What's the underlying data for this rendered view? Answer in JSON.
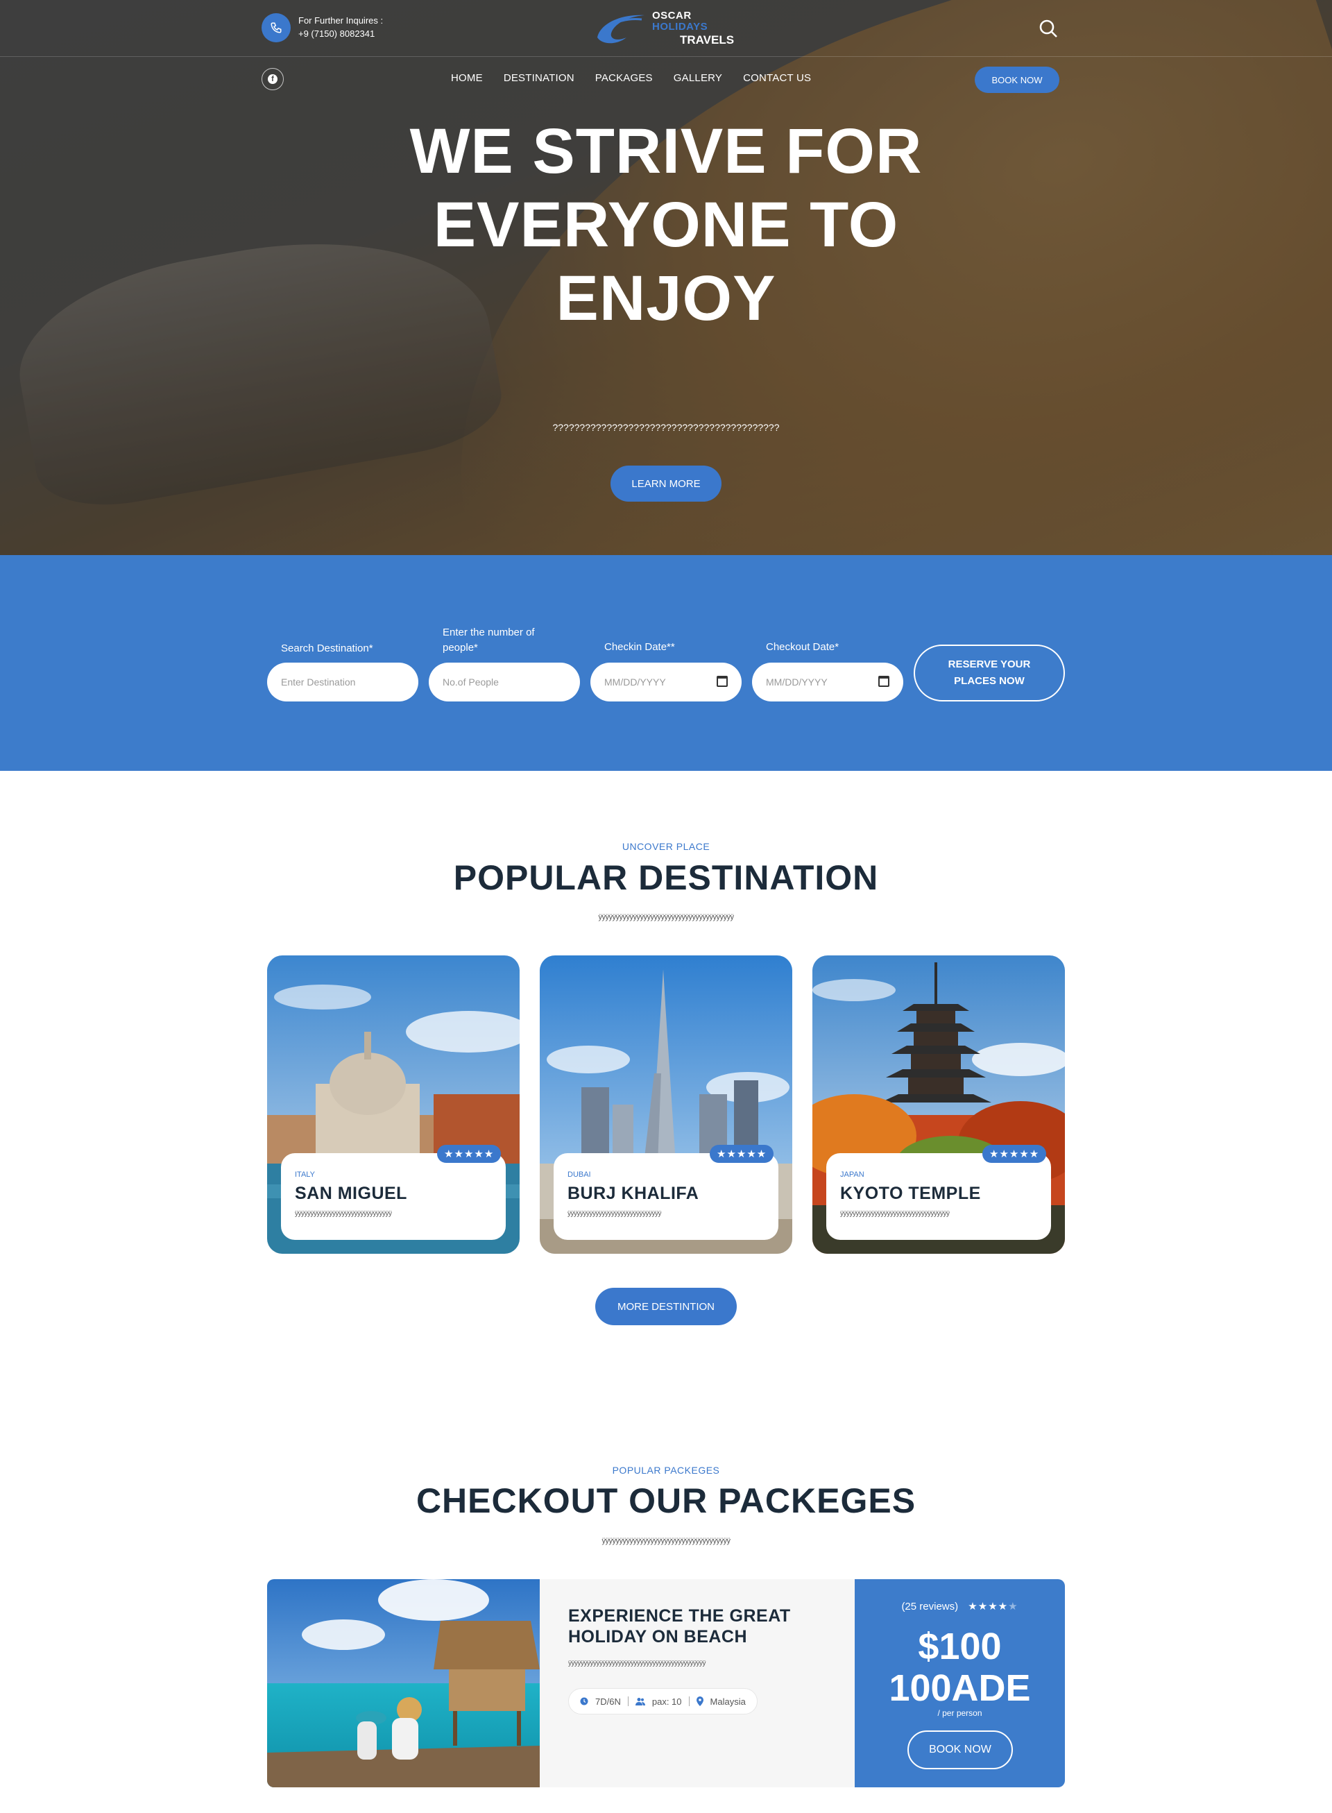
{
  "header": {
    "inquiry_label": "For Further Inquires :",
    "phone": "+9 (7150) 8082341",
    "logo": {
      "line1": "OSCAR",
      "line2": "HOLIDAYS",
      "line3": "TRAVELS"
    },
    "nav": [
      "HOME",
      "DESTINATION",
      "PACKAGES",
      "GALLERY",
      "CONTACT US"
    ],
    "book_now": "BOOK NOW",
    "social": "f",
    "icons": [
      "phone-icon",
      "search-icon",
      "facebook-icon"
    ]
  },
  "hero": {
    "title": "WE STRIVE FOR EVERYONE TO ENJOY",
    "subtitle": "??????????????????????????????????????????",
    "cta": "LEARN MORE"
  },
  "booking": {
    "destination": {
      "label": "Search Destination*",
      "placeholder": "Enter Destination"
    },
    "people": {
      "label": "Enter the number of people*",
      "placeholder": "No.of People"
    },
    "checkin": {
      "label": "Checkin Date**",
      "placeholder": "MM/DD/YYYY"
    },
    "checkout": {
      "label": "Checkout Date*",
      "placeholder": "MM/DD/YYYY"
    },
    "submit": "RESERVE YOUR PLACES NOW"
  },
  "destinations": {
    "eyebrow": "UNCOVER PLACE",
    "title": "POPULAR DESTINATION",
    "subtitle": "ÿÿÿÿÿÿÿÿÿÿÿÿÿÿÿÿÿÿÿÿÿÿÿÿÿÿÿÿÿÿÿÿÿÿÿÿÿÿÿ",
    "cards": [
      {
        "country": "ITALY",
        "name": "SAN MIGUEL",
        "rating": "★★★★★",
        "rating_value": 5,
        "desc": "ÿÿÿÿÿÿÿÿÿÿÿÿÿÿÿÿÿÿÿÿÿÿÿÿÿÿÿÿÿÿÿ"
      },
      {
        "country": "DUBAI",
        "name": "BURJ KHALIFA",
        "rating": "★★★★★",
        "rating_value": 5,
        "desc": "ÿÿÿÿÿÿÿÿÿÿÿÿÿÿÿÿÿÿÿÿÿÿÿÿÿÿÿÿÿÿ"
      },
      {
        "country": "JAPAN",
        "name": "KYOTO TEMPLE",
        "rating": "★★★★★",
        "rating_value": 5,
        "desc": "ÿÿÿÿÿÿÿÿÿÿÿÿÿÿÿÿÿÿÿÿÿÿÿÿÿÿÿÿÿÿÿÿÿÿÿ"
      }
    ],
    "more": "MORE DESTINTION"
  },
  "packages": {
    "eyebrow": "POPULAR PACKEGES",
    "title": "CHECKOUT OUR PACKEGES",
    "subtitle": "ÿÿÿÿÿÿÿÿÿÿÿÿÿÿÿÿÿÿÿÿÿÿÿÿÿÿÿÿÿÿÿÿÿÿÿÿÿ",
    "item": {
      "title": "EXPERIENCE THE GREAT HOLIDAY ON BEACH",
      "desc": "ÿÿÿÿÿÿÿÿÿÿÿÿÿÿÿÿÿÿÿÿÿÿÿÿÿÿÿÿÿÿÿÿÿÿÿÿÿÿÿÿÿÿÿÿ",
      "duration": "7D/6N",
      "pax": "pax: 10",
      "location": "Malaysia",
      "reviews": "(25 reviews)",
      "rating": "★★★★★",
      "rating_value": 4,
      "price_line1": "$100",
      "price_line2": "100ADE",
      "per": "/ per person",
      "book": "BOOK NOW"
    }
  },
  "colors": {
    "accent": "#3b78cc",
    "band": "#3d7ccb",
    "heading": "#1c2b3a"
  }
}
